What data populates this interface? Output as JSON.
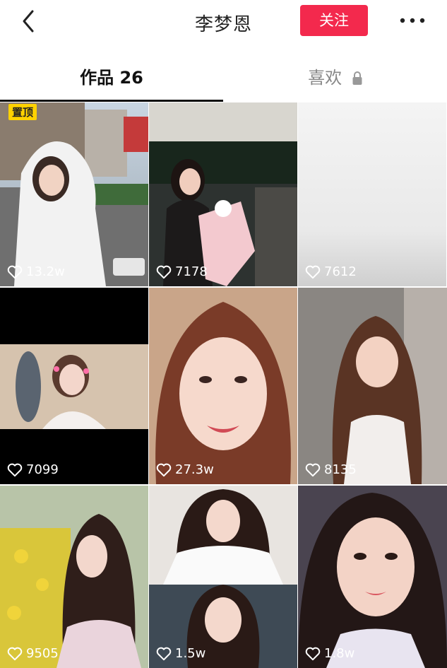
{
  "header": {
    "title": "李梦恩",
    "follow_label": "关注",
    "icons": {
      "back": "back-arrow-icon",
      "more": "more-dots-icon"
    }
  },
  "tabs": {
    "works_label": "作品 26",
    "likes_label": "喜欢",
    "likes_locked_icon": "lock-icon"
  },
  "colors": {
    "accent": "#f3294d",
    "pin_badge": "#ffd200"
  },
  "videos": [
    {
      "likes": "13.2w",
      "pinned_label": "置顶"
    },
    {
      "likes": "7178"
    },
    {
      "likes": "7612"
    },
    {
      "likes": "7099"
    },
    {
      "likes": "27.3w"
    },
    {
      "likes": "8135"
    },
    {
      "likes": "9505"
    },
    {
      "likes": "1.5w"
    },
    {
      "likes": "1.8w"
    }
  ]
}
